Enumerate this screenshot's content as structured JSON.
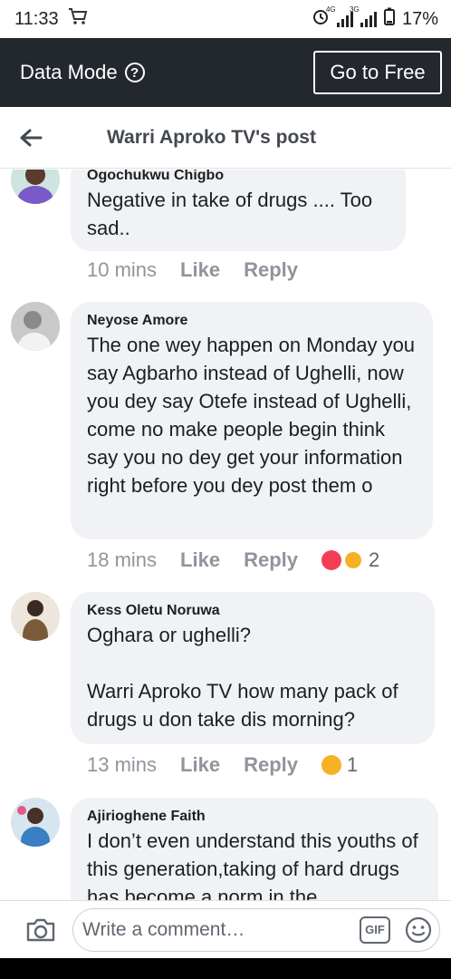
{
  "status": {
    "time": "11:33",
    "net1": "4G",
    "net2": "3G",
    "battery": "17%"
  },
  "databar": {
    "label": "Data Mode",
    "help": "?",
    "button": "Go to Free"
  },
  "header": {
    "title": "Warri Aproko TV's post"
  },
  "comments": [
    {
      "author": "Ogochukwu Chigbo",
      "text": "Negative in take of drugs .... Too sad..",
      "time": "10 mins",
      "like": "Like",
      "reply": "Reply",
      "react_count": ""
    },
    {
      "author": "Neyose Amore",
      "text": "The one wey happen on Monday you say Agbarho instead of Ughelli, now you dey say Otefe instead of Ughelli, come no make people begin think say you no dey get your information right before you dey post them o",
      "time": "18 mins",
      "like": "Like",
      "reply": "Reply",
      "react_count": "2"
    },
    {
      "author": "Kess Oletu Noruwa",
      "text": "Oghara or ughelli?\n\nWarri Aproko TV how many pack of drugs u don take dis morning?",
      "time": "13 mins",
      "like": "Like",
      "reply": "Reply",
      "react_count": "1"
    },
    {
      "author": "Ajirioghene Faith",
      "text": "I don’t even understand this youths of this generation,taking of hard drugs has become a norm in the"
    }
  ],
  "composer": {
    "placeholder": "Write a comment…",
    "gif": "GIF"
  },
  "colors": {
    "bar": "#23272e",
    "bubble": "#f0f2f5",
    "meta": "#90949c"
  }
}
